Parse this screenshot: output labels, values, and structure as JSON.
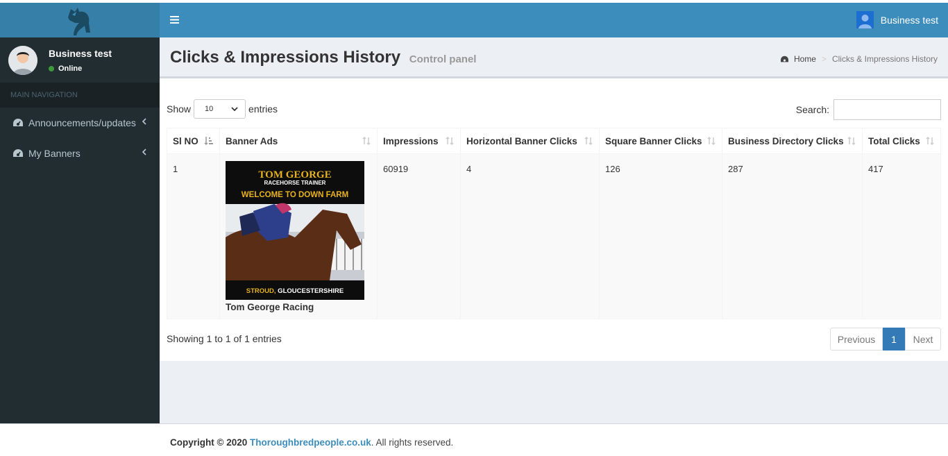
{
  "user": {
    "name": "Business test",
    "status": "Online"
  },
  "sidebar": {
    "nav_header": "MAIN NAVIGATION",
    "items": [
      {
        "label": "Announcements/updates",
        "icon": "dashboard-icon"
      },
      {
        "label": "My Banners",
        "icon": "dashboard-icon"
      }
    ]
  },
  "header": {
    "user_name": "Business test"
  },
  "page": {
    "title": "Clicks & Impressions History",
    "subtitle": "Control panel",
    "breadcrumb": {
      "home": "Home",
      "current": "Clicks & Impressions History"
    }
  },
  "table_controls": {
    "show_label": "Show",
    "entries_value": "10",
    "entries_label": "entries",
    "search_label": "Search:"
  },
  "table": {
    "columns": [
      "Sl NO",
      "Banner Ads",
      "Impressions",
      "Horizontal Banner Clicks",
      "Square Banner Clicks",
      "Business Directory Clicks",
      "Total Clicks"
    ],
    "rows": [
      {
        "sl_no": "1",
        "banner": {
          "name": "Tom George Racing",
          "image_text": {
            "title": "TOM GEORGE",
            "subtitle": "RACEHORSE TRAINER",
            "tagline": "WELCOME TO DOWN FARM",
            "location_a": "STROUD,",
            "location_b": " GLOUCESTERSHIRE"
          }
        },
        "impressions": "60919",
        "horizontal_clicks": "4",
        "square_clicks": "126",
        "directory_clicks": "287",
        "total_clicks": "417"
      }
    ]
  },
  "pagination": {
    "info": "Showing 1 to 1 of 1 entries",
    "previous": "Previous",
    "page": "1",
    "next": "Next"
  },
  "footer": {
    "prefix": "Copyright © 2020 ",
    "link": "Thoroughbredpeople.co.uk",
    "suffix": ". All rights reserved."
  },
  "colors": {
    "header": "#3c8dbc",
    "logo_bg": "#367fa9",
    "sidebar": "#222d32",
    "content_bg": "#ecf0f5",
    "accent": "#337ab7",
    "banner_gold": "#e8b21b"
  }
}
